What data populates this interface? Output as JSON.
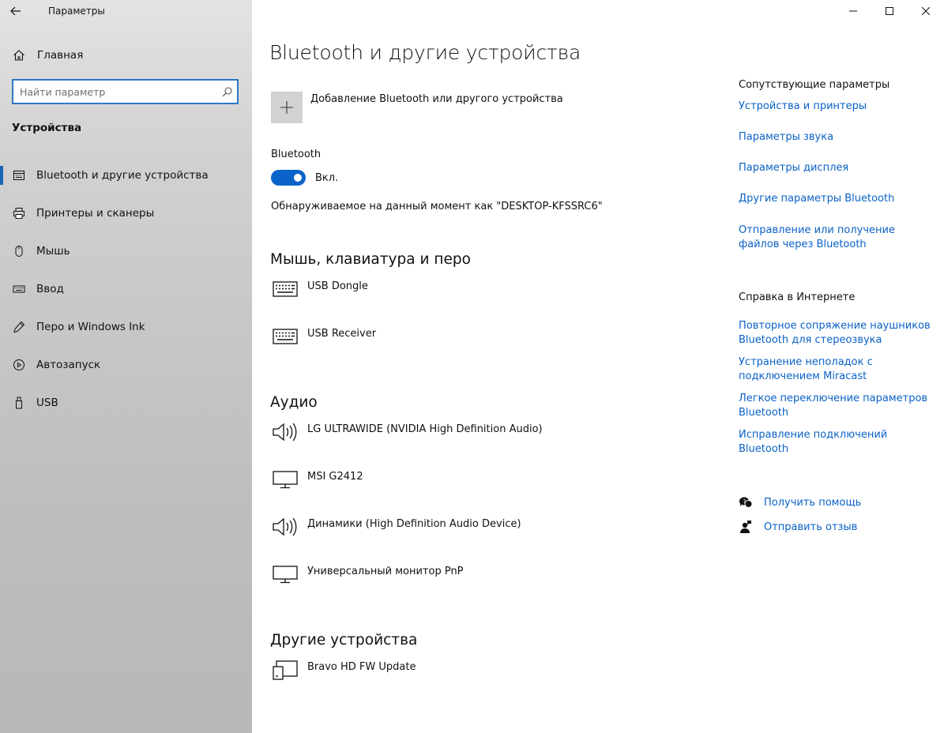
{
  "window": {
    "title": "Параметры",
    "back_icon": "back-arrow-icon",
    "controls": [
      "minimize-icon",
      "maximize-icon",
      "close-icon"
    ]
  },
  "sidebar": {
    "home_label": "Главная",
    "search_placeholder": "Найти параметр",
    "section": "Устройства",
    "items": [
      {
        "label": "Bluetooth и другие устройства",
        "icon": "bluetooth-devices-icon",
        "active": true
      },
      {
        "label": "Принтеры и сканеры",
        "icon": "printer-icon",
        "active": false
      },
      {
        "label": "Мышь",
        "icon": "mouse-icon",
        "active": false
      },
      {
        "label": "Ввод",
        "icon": "keyboard-icon",
        "active": false
      },
      {
        "label": "Перо и Windows Ink",
        "icon": "pen-icon",
        "active": false
      },
      {
        "label": "Автозапуск",
        "icon": "autoplay-icon",
        "active": false
      },
      {
        "label": "USB",
        "icon": "usb-icon",
        "active": false
      }
    ]
  },
  "main": {
    "title": "Bluetooth и другие устройства",
    "add_device_label": "Добавление Bluetooth или другого устройства",
    "bluetooth_label": "Bluetooth",
    "bluetooth_state": "Вкл.",
    "bluetooth_on": true,
    "discoverable_text": "Обнаруживаемое на данный момент как \"DESKTOP-KFSSRC6\"",
    "sections": {
      "input": {
        "heading": "Мышь, клавиатура и перо",
        "devices": [
          {
            "name": "USB Dongle",
            "icon": "keyboard-icon"
          },
          {
            "name": "USB Receiver",
            "icon": "keyboard-icon"
          }
        ]
      },
      "audio": {
        "heading": "Аудио",
        "devices": [
          {
            "name": "LG ULTRAWIDE (NVIDIA High Definition Audio)",
            "icon": "speaker-icon"
          },
          {
            "name": "MSI G2412",
            "icon": "monitor-icon"
          },
          {
            "name": "Динамики (High Definition Audio Device)",
            "icon": "speaker-icon"
          },
          {
            "name": "Универсальный монитор PnP",
            "icon": "monitor-icon"
          }
        ]
      },
      "other": {
        "heading": "Другие устройства",
        "devices": [
          {
            "name": "Bravo HD FW Update",
            "icon": "generic-device-icon"
          }
        ]
      }
    }
  },
  "related": {
    "heading": "Сопутствующие параметры",
    "links": [
      "Устройства и принтеры",
      "Параметры звука",
      "Параметры дисплея",
      "Другие параметры Bluetooth",
      "Отправление или получение файлов через Bluetooth"
    ]
  },
  "web_help": {
    "heading": "Справка в Интернете",
    "links": [
      "Повторное сопряжение наушников Bluetooth для стереозвука",
      "Устранение неполадок с подключением Miracast",
      "Легкое переключение параметров Bluetooth",
      "Исправление подключений Bluetooth"
    ]
  },
  "help": {
    "get_help": "Получить помощь",
    "feedback": "Отправить отзыв"
  },
  "colors": {
    "accent": "#0a63c9",
    "link": "#0a62c7"
  }
}
